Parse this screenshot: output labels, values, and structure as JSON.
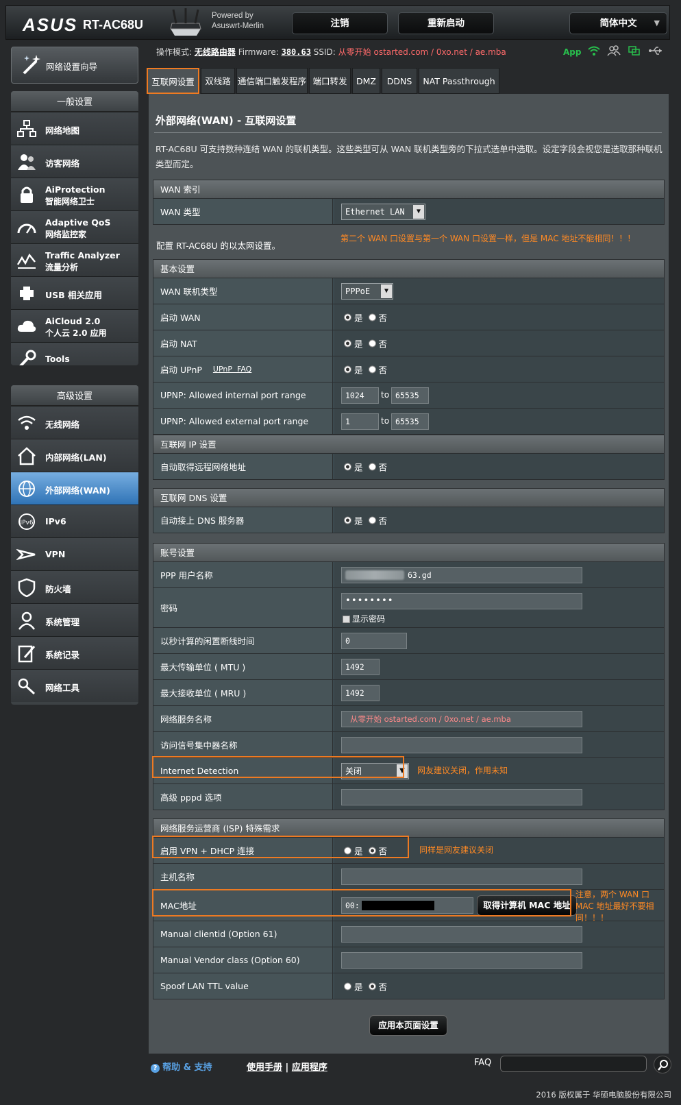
{
  "header": {
    "brand": "ASUS",
    "model": "RT-AC68U",
    "powered_by": "Powered by",
    "firmware_name": "Asuswrt-Merlin",
    "logout_label": "注销",
    "reboot_label": "重新启动",
    "language_label": "简体中文"
  },
  "status": {
    "mode_label": "操作模式:",
    "mode_value": "无线路由器",
    "firmware_label": "Firmware:",
    "firmware_value": "380.63",
    "ssid_label": "SSID:",
    "ssid_value": "从零开始 ostarted.com / 0xo.net / ae.mba",
    "app_label": "App"
  },
  "sidebar": {
    "wizard_label": "网络设置向导",
    "general_heading": "一般设置",
    "general_items": [
      {
        "name": "network-map",
        "t1": "网络地图"
      },
      {
        "name": "guest-network",
        "t1": "访客网络"
      },
      {
        "name": "aiprotection",
        "t1": "AiProtection",
        "t2": "智能网络卫士"
      },
      {
        "name": "adaptive-qos",
        "t1": "Adaptive QoS",
        "t2": "网络监控家"
      },
      {
        "name": "traffic-analyzer",
        "t1": "Traffic Analyzer",
        "t2": "流量分析"
      },
      {
        "name": "usb",
        "t1": "USB 相关应用"
      },
      {
        "name": "aicloud",
        "t1": "AiCloud 2.0",
        "t2": "个人云 2.0 应用"
      },
      {
        "name": "tools",
        "t1": "Tools"
      }
    ],
    "advanced_heading": "高级设置",
    "advanced_items": [
      {
        "name": "wireless",
        "t1": "无线网络"
      },
      {
        "name": "lan",
        "t1": "内部网络(LAN)"
      },
      {
        "name": "wan",
        "t1": "外部网络(WAN)",
        "active": true
      },
      {
        "name": "ipv6",
        "t1": "IPv6"
      },
      {
        "name": "vpn",
        "t1": "VPN"
      },
      {
        "name": "firewall",
        "t1": "防火墙"
      },
      {
        "name": "administration",
        "t1": "系统管理"
      },
      {
        "name": "system-log",
        "t1": "系统记录"
      },
      {
        "name": "network-tools",
        "t1": "网络工具"
      }
    ]
  },
  "tabs": [
    "互联网设置",
    "双线路",
    "通信端口触发程序",
    "端口转发",
    "DMZ",
    "DDNS",
    "NAT Passthrough"
  ],
  "page": {
    "title": "外部网络(WAN) - 互联网设置",
    "description": "RT-AC68U 可支持数种连结 WAN 的联机类型。这些类型可从 WAN 联机类型旁的下拉式选单中选取。设定字段会视您是选取那种联机类型而定。",
    "wan_index_heading": "WAN 索引",
    "wan_type_label": "WAN 类型",
    "wan_type_value": "Ethernet LAN",
    "config_text": "配置 RT-AC68U 的以太网设置。",
    "note_mac_same": "第二个 WAN 口设置与第一个 WAN 口设置一样，但是 MAC 地址不能相同！！！",
    "basic_heading": "基本设置",
    "conn_type_label": "WAN 联机类型",
    "conn_type_value": "PPPoE",
    "enable_wan_label": "启动 WAN",
    "enable_nat_label": "启动 NAT",
    "enable_upnp_label": "启动 UPnP",
    "upnp_faq": "UPnP  FAQ",
    "upnp_internal_label": "UPNP: Allowed internal port range",
    "upnp_internal_from": "1024",
    "upnp_internal_to": "65535",
    "upnp_external_label": "UPNP: Allowed external port range",
    "upnp_external_from": "1",
    "upnp_external_to": "65535",
    "to_label": "to",
    "yes": "是",
    "no": "否",
    "ip_heading": "互联网 IP 设置",
    "auto_ip_label": "自动取得远程网络地址",
    "dns_heading": "互联网 DNS 设置",
    "auto_dns_label": "自动接上 DNS 服务器",
    "account_heading": "账号设置",
    "ppp_user_label": "PPP 用户名称",
    "ppp_user_value": "63.gd",
    "password_label": "密码",
    "password_value": "••••••••",
    "show_password": "显示密码",
    "idle_label": "以秒计算的闲置断线时间",
    "idle_value": "0",
    "mtu_label": "最大传输单位 ( MTU )",
    "mtu_value": "1492",
    "mru_label": "最大接收单位 ( MRU )",
    "mru_value": "1492",
    "service_label": "网络服务名称",
    "service_value": "从零开始 ostarted.com / 0xo.net / ae.mba",
    "ac_label": "访问信号集中器名称",
    "internet_detect_label": "Internet Detection",
    "internet_detect_value": "关闭",
    "note_detect": "网友建议关闭，作用未知",
    "pppd_label": "高级 pppd 选项",
    "isp_heading": "网络服务运营商 (ISP) 特殊需求",
    "vpn_dhcp_label": "启用 VPN + DHCP 连接",
    "note_vpn": "同样是网友建议关闭",
    "host_label": "主机名称",
    "mac_label": "MAC地址",
    "mac_value": "00:",
    "mac_button": "取得计算机 MAC 地址",
    "note_mac": "注意，两个 WAN 口 MAC 地址最好不要相同！！！",
    "clientid_label": "Manual clientid (Option 61)",
    "vendor_label": "Manual Vendor class (Option 60)",
    "ttl_label": "Spoof LAN TTL value",
    "apply_label": "应用本页面设置"
  },
  "footer": {
    "help": "帮助 & 支持",
    "manual": "使用手册",
    "sep": "|",
    "app": "应用程序",
    "faq": "FAQ",
    "copyright": "2016 版权属于 华硕电脑股份有限公司"
  },
  "colors": {
    "accent_orange": "#f07b21",
    "active_blue": "#2f73b6",
    "note_orange": "#ff8a24",
    "ssid_red": "#ff6a6a"
  }
}
